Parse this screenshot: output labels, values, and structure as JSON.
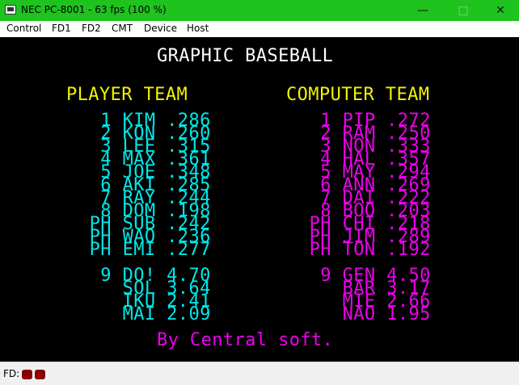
{
  "window": {
    "title": "NEC PC-8001 - 63 fps (100 %)",
    "minimize_glyph": "—",
    "maximize_glyph": "□",
    "close_glyph": "✕"
  },
  "menu": [
    "Control",
    "FD1",
    "FD2",
    "CMT",
    "Device",
    "Host"
  ],
  "screen": {
    "title": "GRAPHIC BASEBALL",
    "player_heading": "PLAYER TEAM",
    "computer_heading": "COMPUTER TEAM",
    "player_lineup": [
      "  1 KIM .286",
      "  2 KON .260",
      "  3 LEE .315",
      "  4 MAX .361",
      "  5 JOE .348",
      "  6 AKI .285",
      "  7 RAY .244",
      "  8 DOM .198",
      " PH SUB .242",
      " PH WAO .236",
      " PH EMI .277"
    ],
    "player_pitchers": [
      "  9 DO! 4.70",
      "    SOL 3.64",
      "    IKU 2.41",
      "    MAI 2.09"
    ],
    "computer_lineup": [
      "  1 PIP .272",
      "  2 RAM .250",
      "  3 NON .333",
      "  4 HAL .357",
      "  5 MAY .294",
      "  6 ANN .269",
      "  7 DAI .222",
      "  8 BOO .203",
      " PH CHI .218",
      " PH JIM .289",
      " PH TON .192"
    ],
    "computer_pitchers": [
      "  9 GEN 4.50",
      "    BAR 3.17",
      "    MIE 2.66",
      "    NAO 1.95"
    ],
    "credit": "By Central soft."
  },
  "status": {
    "fd_label": "FD:"
  }
}
